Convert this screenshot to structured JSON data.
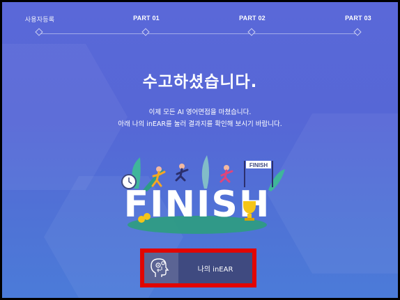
{
  "steps": [
    {
      "label": "사용자등록"
    },
    {
      "label": "PART 01"
    },
    {
      "label": "PART 02"
    },
    {
      "label": "PART 03"
    }
  ],
  "heading": "수고하셨습니다.",
  "message": {
    "line1": "이제 모든 AI 영어면접을 마쳤습니다.",
    "line2": "아래 나의 inEAR를 눌러 결과지를 확인해 보시기 바랍니다."
  },
  "illustration": {
    "word": "FINISH",
    "banner": "FINISH",
    "icon": "finish-celebration-illustration"
  },
  "result_button": {
    "label": "나의 inEAR",
    "icon": "brain-gear-icon",
    "highlight_color": "#e10600"
  },
  "colors": {
    "background_top": "#5a68d8",
    "background_bottom": "#4b7bd8",
    "button_bg": "#3f4a80"
  }
}
